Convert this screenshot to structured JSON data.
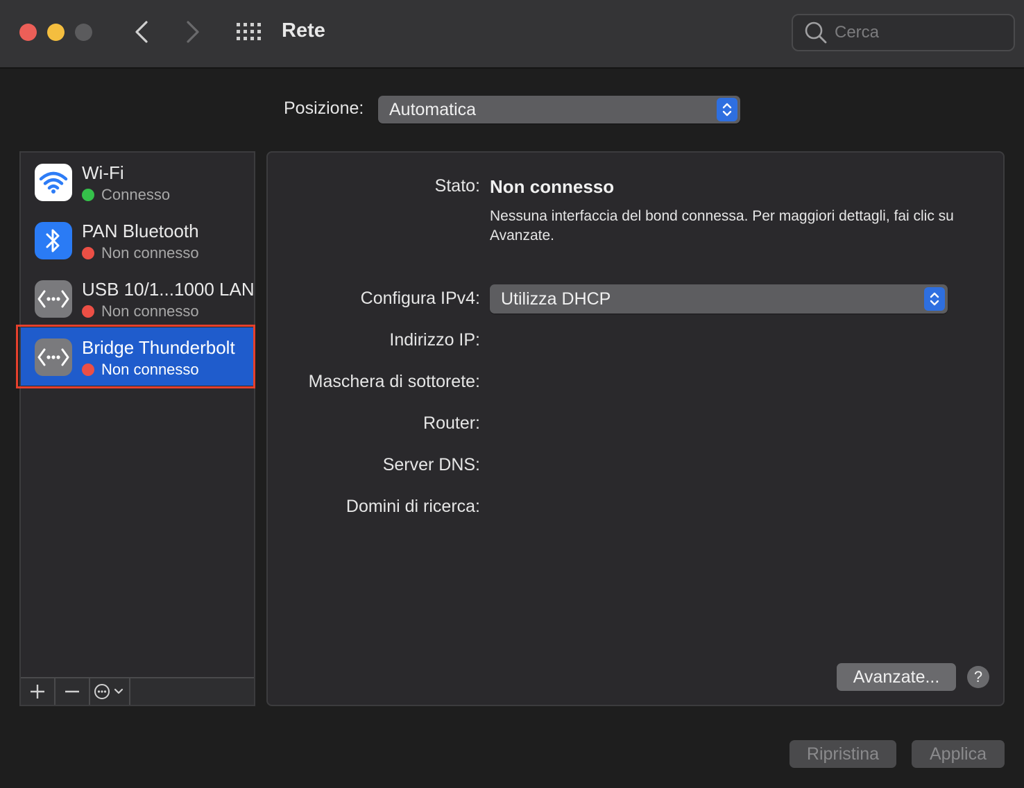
{
  "window": {
    "title": "Rete"
  },
  "search": {
    "placeholder": "Cerca"
  },
  "location": {
    "label": "Posizione:",
    "value": "Automatica"
  },
  "services": [
    {
      "name": "Wi-Fi",
      "status": "Connesso",
      "status_color": "#35c14a",
      "icon": "wifi-icon"
    },
    {
      "name": "PAN Bluetooth",
      "status": "Non connesso",
      "status_color": "#ec4f45",
      "icon": "bluetooth-icon"
    },
    {
      "name": "USB 10/1...1000 LAN",
      "status": "Non connesso",
      "status_color": "#ec4f45",
      "icon": "ethernet-icon"
    },
    {
      "name": "Bridge Thunderbolt",
      "status": "Non connesso",
      "status_color": "#ec4f45",
      "icon": "ethernet-icon",
      "selected": true
    }
  ],
  "detail": {
    "state_label": "Stato:",
    "state_value": "Non connesso",
    "state_description": "Nessuna interfaccia del bond connessa. Per maggiori dettagli, fai clic su Avanzate.",
    "ipv4_label": "Configura IPv4:",
    "ipv4_value": "Utilizza DHCP",
    "ip_label": "Indirizzo IP:",
    "subnet_label": "Maschera di sottorete:",
    "router_label": "Router:",
    "dns_label": "Server DNS:",
    "search_domains_label": "Domini di ricerca:",
    "advanced_button": "Avanzate...",
    "help_button": "?"
  },
  "footer": {
    "revert_button": "Ripristina",
    "apply_button": "Applica"
  },
  "colors": {
    "accent": "#1f5ccc",
    "highlight": "#e5402c"
  }
}
